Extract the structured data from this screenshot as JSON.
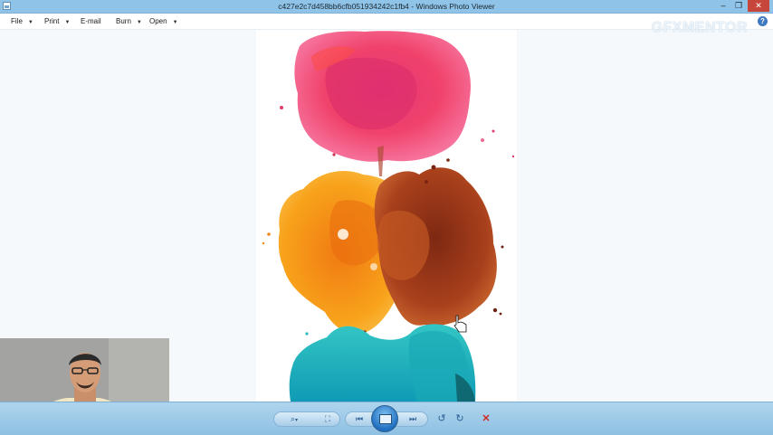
{
  "window": {
    "title": "c427e2c7d458bb6cfb051934242c1fb4 - Windows Photo Viewer",
    "controls": {
      "minimize_glyph": "–",
      "restore_glyph": "❐",
      "close_glyph": "✕"
    }
  },
  "menu": {
    "items": [
      {
        "label": "File",
        "has_dropdown": true
      },
      {
        "label": "Print",
        "has_dropdown": true
      },
      {
        "label": "E-mail",
        "has_dropdown": false
      },
      {
        "label": "Burn",
        "has_dropdown": true
      },
      {
        "label": "Open",
        "has_dropdown": true
      }
    ],
    "dropdown_glyph": "▼",
    "help_glyph": "?"
  },
  "watermark": {
    "text": "GFXMENTOR"
  },
  "photo": {
    "subject": "watercolor splash painting",
    "icon": "image"
  },
  "toolbar": {
    "zoom_glyph": "⌕",
    "zoom_dropdown_glyph": "▾",
    "actual_size_glyph": "⛶",
    "previous_glyph": "⏮",
    "next_glyph": "⏭",
    "rotate_ccw_glyph": "↺",
    "rotate_cw_glyph": "↻",
    "delete_glyph": "✕"
  },
  "colors": {
    "titlebar": "#8fc3e7",
    "toolbar": "#a4cfec",
    "viewer_background": "#f5f9fc",
    "delete": "#d12a20"
  }
}
